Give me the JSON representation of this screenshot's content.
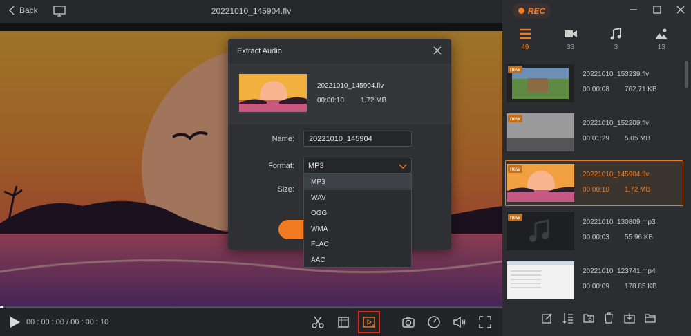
{
  "titlebar": {
    "back_label": "Back",
    "file_title": "20221010_145904.flv"
  },
  "rec": {
    "label": "REC"
  },
  "filter_tabs": [
    {
      "name": "all",
      "count": "49"
    },
    {
      "name": "video",
      "count": "33"
    },
    {
      "name": "audio",
      "count": "3"
    },
    {
      "name": "image",
      "count": "13"
    }
  ],
  "recordings": [
    {
      "name": "20221010_153239.flv",
      "duration": "00:00:08",
      "size": "762.71 KB",
      "badge": "new"
    },
    {
      "name": "20221010_152209.flv",
      "duration": "00:01:29",
      "size": "5.05 MB",
      "badge": "new"
    },
    {
      "name": "20221010_145904.flv",
      "duration": "00:00:10",
      "size": "1.72 MB",
      "badge": "new"
    },
    {
      "name": "20221010_130809.mp3",
      "duration": "00:00:03",
      "size": "55.96 KB",
      "badge": "new"
    },
    {
      "name": "20221010_123741.mp4",
      "duration": "00:00:09",
      "size": "178.85 KB",
      "badge": ""
    }
  ],
  "player": {
    "time": "00 : 00 : 00 / 00 : 00 : 10",
    "progress": 0.0
  },
  "dialog": {
    "title": "Extract Audio",
    "file_name": "20221010_145904.flv",
    "duration": "00:00:10",
    "size": "1.72 MB",
    "name_label": "Name:",
    "name_value": "20221010_145904",
    "format_label": "Format:",
    "format_value": "MP3",
    "size_label": "Size:",
    "format_options": [
      "MP3",
      "WAV",
      "OGG",
      "WMA",
      "FLAC",
      "AAC"
    ]
  },
  "colors": {
    "accent": "#f07b22",
    "highlight": "#e0281a"
  }
}
